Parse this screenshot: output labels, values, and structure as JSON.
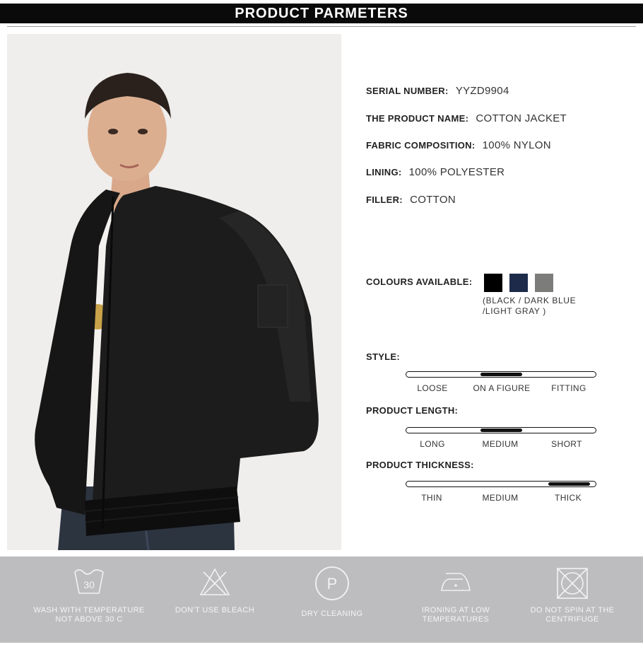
{
  "header": {
    "title": "PRODUCT PARMETERS"
  },
  "specs": [
    {
      "label": "SERIAL NUMBER:",
      "value": "YYZD9904"
    },
    {
      "label": "THE PRODUCT NAME:",
      "value": "COTTON JACKET"
    },
    {
      "label": "FABRIC COMPOSITION:",
      "value": "100% NYLON"
    },
    {
      "label": "LINING:",
      "value": "100% POLYESTER"
    },
    {
      "label": "FILLER:",
      "value": "COTTON"
    }
  ],
  "colors": {
    "label": "COLOURS AVAILABLE:",
    "swatches": [
      "#000000",
      "#1d2a4a",
      "#7c7c7a"
    ],
    "note_line1": "(BLACK / DARK BLUE",
    "note_line2": "/LIGHT GRAY )"
  },
  "scales": {
    "style": {
      "label": "STYLE:",
      "ticks": [
        "LOOSE",
        "ON A FIGURE",
        "FITTING"
      ],
      "selected": "ON A FIGURE"
    },
    "length": {
      "label": "PRODUCT LENGTH:",
      "ticks": [
        "LONG",
        "MEDIUM",
        "SHORT"
      ],
      "selected": "MEDIUM"
    },
    "thickness": {
      "label": "PRODUCT THICKNESS:",
      "ticks": [
        "THIN",
        "MEDIUM",
        "THICK"
      ],
      "selected": "THICK"
    }
  },
  "care": [
    {
      "icon": "wash-30-icon",
      "line1": "WASH WITH TEMPERATURE",
      "line2": "NOT ABOVE 30 C",
      "number": "30"
    },
    {
      "icon": "no-bleach-icon",
      "line1": "DON'T USE BLEACH",
      "line2": ""
    },
    {
      "icon": "dry-cleaning-icon",
      "line1": "DRY CLEANING",
      "line2": "",
      "letter": "P"
    },
    {
      "icon": "iron-low-icon",
      "line1": "IRONING AT LOW",
      "line2": "TEMPERATURES"
    },
    {
      "icon": "no-spin-icon",
      "line1": "DO NOT SPIN AT THE",
      "line2": "CENTRIFUGE"
    }
  ]
}
